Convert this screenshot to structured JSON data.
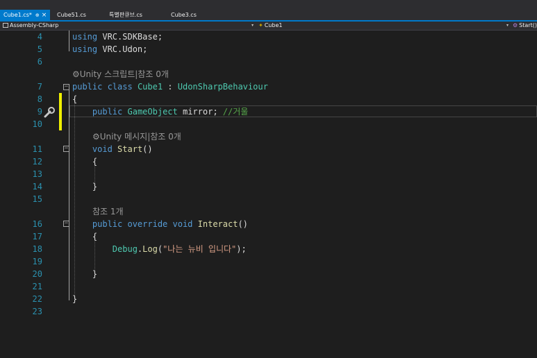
{
  "tabs": [
    {
      "label": "Cube1.cs*",
      "active": true,
      "pin": "⊕",
      "close": "×"
    },
    {
      "label": "Cube51.cs",
      "active": false
    },
    {
      "label": "특별판큐브.cs",
      "active": false
    },
    {
      "label": "Cube3.cs",
      "active": false
    }
  ],
  "nav": {
    "project": "Assembly-CSharp",
    "class_name": "Cube1",
    "member": "Start()",
    "dropdown_glyph": "▾"
  },
  "gutter": {
    "line_numbers": [
      "4",
      "5",
      "6",
      "7",
      "8",
      "9",
      "10",
      "11",
      "12",
      "13",
      "14",
      "15",
      "16",
      "17",
      "18",
      "19",
      "20",
      "21",
      "22",
      "23"
    ]
  },
  "codelens": {
    "unity_script": "⚙Unity 스크립트|참조 0개",
    "unity_message": "⚙Unity 메시지|참조 0개",
    "ref_one": "참조 1개"
  },
  "code": {
    "l4_kw": "using",
    "l4_rest": " VRC.SDKBase;",
    "l5_kw": "using",
    "l5_rest": " VRC.Udon;",
    "l7_kw": "public class",
    "l7_sp": " ",
    "l7_type": "Cube1",
    "l7_colon": " : ",
    "l7_base": "UdonSharpBehaviour",
    "l8": "{",
    "l9_kw": "public",
    "l9_sp": " ",
    "l9_type": "GameObject",
    "l9_rest": " mirror; ",
    "l9_comment": "//거울",
    "l11_kw": "void",
    "l11_sp": " ",
    "l11_fn": "Start",
    "l11_rest": "()",
    "l12": "{",
    "l14": "}",
    "l16_kw": "public override void",
    "l16_sp": " ",
    "l16_fn": "Interact",
    "l16_rest": "()",
    "l17": "{",
    "l18_type": "Debug",
    "l18_dot": ".",
    "l18_fn": "Log",
    "l18_open": "(",
    "l18_str": "\"나는 뉴비 입니다\"",
    "l18_close": ");",
    "l20": "}",
    "l22": "}"
  },
  "colors": {
    "accent": "#007acc",
    "keyword": "#569cd6",
    "type": "#4ec9b0",
    "method": "#dcdcaa",
    "string": "#d69d85",
    "comment": "#57a64a",
    "line_number": "#2b91af",
    "change_marker": "#efef00"
  },
  "icons": {
    "quick_action": "wrench-icon",
    "project": "csharp-project-icon",
    "class": "class-icon",
    "member": "method-icon"
  }
}
